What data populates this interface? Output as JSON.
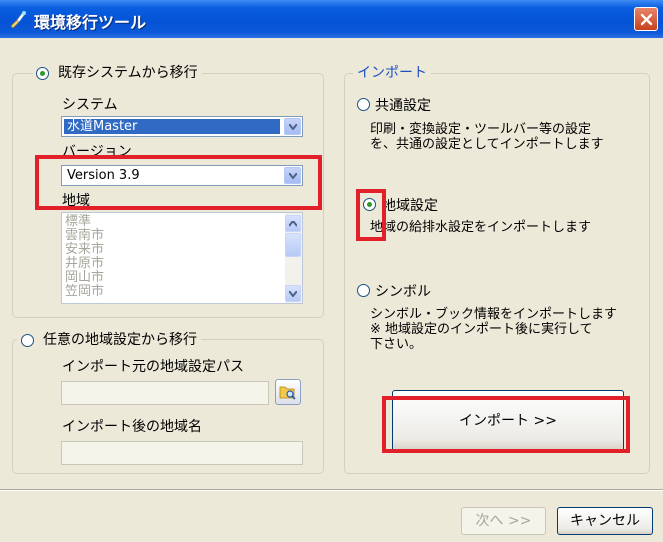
{
  "window": {
    "title": "環境移行ツール"
  },
  "left": {
    "existing_system_radio": "既存システムから移行",
    "system_label": "システム",
    "system_value": "水道Master",
    "version_label": "バージョン",
    "version_value": "Version 3.9",
    "region_label": "地域",
    "region_items": [
      "標準",
      "雲南市",
      "安来市",
      "井原市",
      "岡山市",
      "笠岡市"
    ],
    "arbitrary_radio": "任意の地域設定から移行",
    "import_source_path_label": "インポート元の地域設定パス",
    "import_dest_region_label": "インポート後の地域名"
  },
  "right": {
    "group_title": "インポート",
    "common_radio": "共通設定",
    "common_desc_1": "印刷・変換設定・ツールバー等の設定",
    "common_desc_2": "を、共通の設定としてインポートします",
    "region_radio": "地域設定",
    "region_desc": "地域の給排水設定をインポートします",
    "symbol_radio": "シンボル",
    "symbol_desc_1": "シンボル・ブック情報をインポートします",
    "symbol_desc_2": "※ 地域設定のインポート後に実行して",
    "symbol_desc_3": "下さい。",
    "import_button": "インポート >>"
  },
  "footer": {
    "next_button": "次へ >>",
    "cancel_button": "キャンセル"
  },
  "colors": {
    "titlebar": "#0553d6",
    "highlight": "#e2202a",
    "selection": "#316ac5"
  }
}
